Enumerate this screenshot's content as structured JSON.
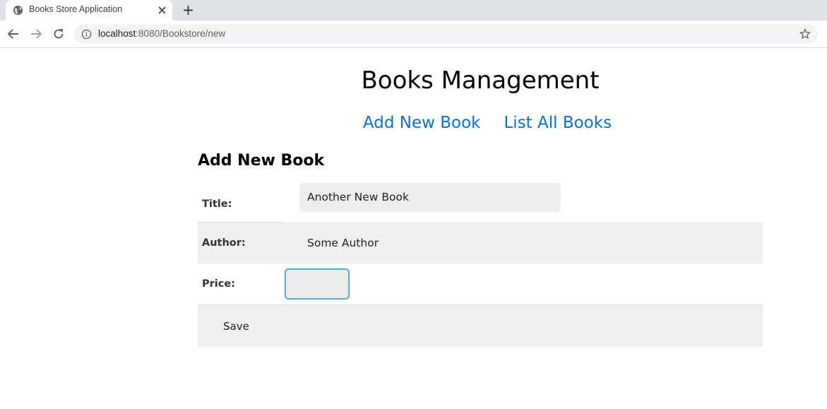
{
  "browser": {
    "tab_title": "Books Store Application",
    "url_host": "localhost",
    "url_path": ":8080/Bookstore/new"
  },
  "page": {
    "title": "Books Management",
    "nav": {
      "add_new": "Add New Book",
      "list_all": "List All Books"
    },
    "form": {
      "caption": "Add New Book",
      "title_label": "Title:",
      "title_value": "Another New Book",
      "author_label": "Author:",
      "author_value": "Some Author",
      "price_label": "Price:",
      "price_value": "",
      "save_label": "Save"
    }
  },
  "colors": {
    "link": "#0d6fc7",
    "focus_ring": "#59b0d6",
    "row_alt": "#efefef"
  },
  "icons": [
    "globe-icon",
    "close-icon",
    "plus-icon",
    "back-arrow-icon",
    "forward-arrow-icon",
    "reload-icon",
    "info-icon",
    "star-icon"
  ]
}
